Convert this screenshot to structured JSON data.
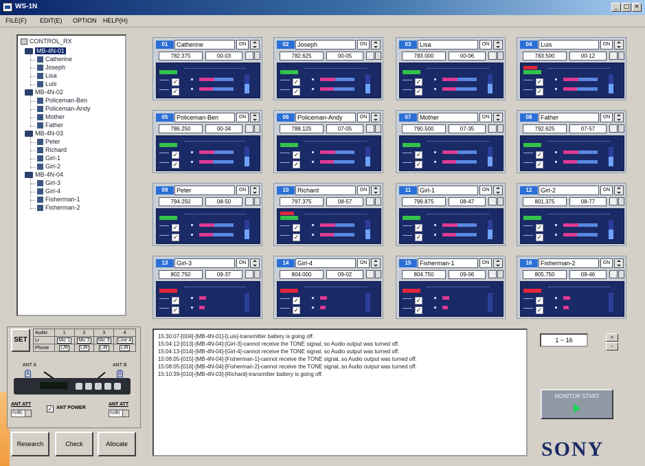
{
  "window": {
    "title": "WS-1N"
  },
  "menu": [
    "FILE(F)",
    "EDIT(E)",
    "OPTION",
    "HELP(H)"
  ],
  "tree": {
    "root": "CONTROL_RX",
    "nodes": [
      {
        "label": "MB-4N-01",
        "children": [
          "Catherine",
          "Joseph",
          "Lisa",
          "Luis"
        ]
      },
      {
        "label": "MB-4N-02",
        "children": [
          "Policeman-Ben",
          "Policeman-Andy",
          "Mother",
          "Father"
        ]
      },
      {
        "label": "MB-4N-03",
        "children": [
          "Peter",
          "Richard",
          "Girl-1",
          "Girl-2"
        ]
      },
      {
        "label": "MB-4N-04",
        "children": [
          "Girl-3",
          "Girl-4",
          "Fisherman-1",
          "Fisherman-2"
        ]
      }
    ]
  },
  "channels": [
    {
      "ch": "01",
      "name": "Catherine",
      "state": "ON",
      "freq": "782.375",
      "group": "00-03",
      "status": "ok"
    },
    {
      "ch": "02",
      "name": "Joseph",
      "state": "ON",
      "freq": "782.625",
      "group": "00-05",
      "status": "ok"
    },
    {
      "ch": "03",
      "name": "Lisa",
      "state": "ON",
      "freq": "783.000",
      "group": "00-06",
      "status": "ok"
    },
    {
      "ch": "04",
      "name": "Luis",
      "state": "ON",
      "freq": "783.500",
      "group": "00-12",
      "status": "warn"
    },
    {
      "ch": "05",
      "name": "Policeman-Ben",
      "state": "ON",
      "freq": "786.250",
      "group": "00-34",
      "status": "ok"
    },
    {
      "ch": "06",
      "name": "Policeman-Andy",
      "state": "ON",
      "freq": "788.125",
      "group": "07-05",
      "status": "ok"
    },
    {
      "ch": "07",
      "name": "Mother",
      "state": "ON",
      "freq": "790.500",
      "group": "07-35",
      "status": "ok"
    },
    {
      "ch": "08",
      "name": "Father",
      "state": "ON",
      "freq": "792.625",
      "group": "07-57",
      "status": "ok"
    },
    {
      "ch": "09",
      "name": "Peter",
      "state": "ON",
      "freq": "794.250",
      "group": "08-50",
      "status": "ok"
    },
    {
      "ch": "10",
      "name": "Richard",
      "state": "ON",
      "freq": "797.375",
      "group": "08-57",
      "status": "warn"
    },
    {
      "ch": "11",
      "name": "Girl-1",
      "state": "ON",
      "freq": "799.875",
      "group": "08-47",
      "status": "ok"
    },
    {
      "ch": "12",
      "name": "Girl-2",
      "state": "ON",
      "freq": "801.375",
      "group": "08-77",
      "status": "ok"
    },
    {
      "ch": "13",
      "name": "Girl-3",
      "state": "ON",
      "freq": "802.750",
      "group": "09-37",
      "status": "alert"
    },
    {
      "ch": "14",
      "name": "Girl-4",
      "state": "ON",
      "freq": "804.000",
      "group": "09-02",
      "status": "alert"
    },
    {
      "ch": "15",
      "name": "Fisherman-1",
      "state": "ON",
      "freq": "804.750",
      "group": "09-06",
      "status": "alert"
    },
    {
      "ch": "16",
      "name": "Fisherman-2",
      "state": "ON",
      "freq": "805.750",
      "group": "09-46",
      "status": "alert"
    }
  ],
  "log": [
    "15:30:07-[004]-[MB-4N-01]-[Luis]-transmitter battery is going off.",
    "15:04:12-[013]-[MB-4N-04]-[Girl-3]-cannot receive the TONE signal, so Audio output was turned off.",
    "15:04:13-[014]-[MB-4N-04]-[Girl-4]-cannot receive the TONE signal, so Audio output was turned off.",
    "15:08:05-[015]-[MB-4N-04]-[Fisherman-1]-cannot receive the TONE signal, so Audio output was turned off.",
    "15:08:05-[016]-[MB-4N-04]-[Fisherman-2]-cannot receive the TONE signal, so Audio output was turned off.",
    "15:10:39-[010]-[MB-4N-03]-[Richard]-transmitter battery is going off."
  ],
  "pager": {
    "range": "1 ~ 16",
    "up": "+",
    "down": "-"
  },
  "monitor_button": "MONITOR START",
  "brand": "SONY",
  "control": {
    "set_label": "SET",
    "table": {
      "headers": [
        "Audio",
        "1",
        "2",
        "3",
        "4"
      ],
      "row_lr": [
        "Lr",
        "Mic 1",
        "Mic 2",
        "Mic 3",
        "Line 4"
      ],
      "row_phone": [
        "Phone",
        "L/R",
        "L/R",
        "L/R",
        "L/R"
      ]
    },
    "ant_a": "ANT A",
    "ant_b": "ANT B",
    "icon_a": "A",
    "icon_b": "B",
    "ant_att_a": "ANT ATT",
    "ant_att_b": "ANT ATT",
    "att_a_value": "0(dB)",
    "att_b_value": "0(dB)",
    "ant_power": "ANT POWER"
  },
  "actions": [
    "Research",
    "Check",
    "Allocate"
  ],
  "colors": {
    "ok": "#33c24a",
    "warn": "#e0283a",
    "badge": "#2c6fd6",
    "meter_bg": "#1a2a66"
  },
  "icons": {
    "check": "✓",
    "close": "×",
    "minimize": "_",
    "maximize": "□"
  }
}
